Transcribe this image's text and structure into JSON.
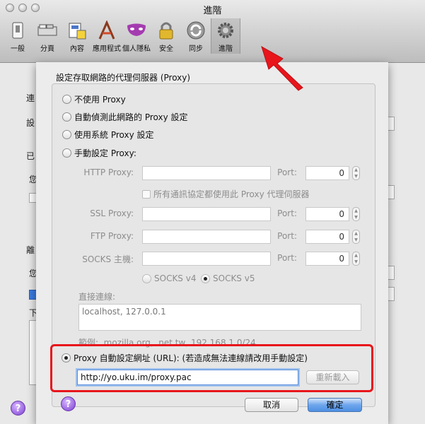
{
  "window": {
    "title": "進階"
  },
  "toolbar": {
    "items": [
      {
        "label": "一般",
        "icon": "switch-icon"
      },
      {
        "label": "分頁",
        "icon": "tabs-icon"
      },
      {
        "label": "內容",
        "icon": "content-icon"
      },
      {
        "label": "應用程式",
        "icon": "applications-icon"
      },
      {
        "label": "個人隱私",
        "icon": "privacy-mask-icon"
      },
      {
        "label": "安全",
        "icon": "lock-icon"
      },
      {
        "label": "同步",
        "icon": "sync-icon"
      },
      {
        "label": "進階",
        "icon": "gear-icon"
      }
    ]
  },
  "background": {
    "labels": [
      "連",
      "設",
      "已",
      "您",
      "離",
      "您",
      "下"
    ]
  },
  "dialog": {
    "title": "設定存取網路的代理伺服器 (Proxy)",
    "options": {
      "no_proxy": "不使用 Proxy",
      "auto_detect": "自動偵測此網路的 Proxy 設定",
      "system": "使用系統 Proxy 設定",
      "manual": "手動設定 Proxy:"
    },
    "fields": {
      "http_label": "HTTP Proxy:",
      "ssl_label": "SSL Proxy:",
      "ftp_label": "FTP Proxy:",
      "socks_label": "SOCKS 主機:",
      "port_label": "Port:",
      "port_value": "0",
      "same_proxy": "所有通訊協定都使用此 Proxy 代理伺服器",
      "socks_v4": "SOCKS v4",
      "socks_v5": "SOCKS v5"
    },
    "no_proxy_for": {
      "label": "直接連線:",
      "value": "localhost, 127.0.0.1",
      "example": "範例: .mozilla.org, .net.tw, 192.168.1.0/24"
    },
    "auto_url": {
      "label": "Proxy 自動設定網址 (URL): (若造成無法連線請改用手動設定)",
      "value": "http://yo.uku.im/proxy.pac",
      "reload": "重新載入"
    },
    "cancel": "取消",
    "ok": "確定",
    "help": "?"
  },
  "colors": {
    "highlight": "#e8151b",
    "default_button": "#4d8fe3"
  }
}
